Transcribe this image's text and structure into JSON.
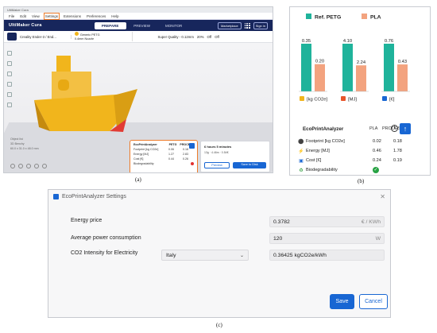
{
  "panel_a": {
    "window_title": "UltiMaker Cura",
    "menu": [
      "File",
      "Edit",
      "View",
      "Settings",
      "Extensions",
      "Preferences",
      "Help"
    ],
    "highlighted_menu": "Settings",
    "logo": "UltiMaker Cura",
    "stages": [
      "PREPARE",
      "PREVIEW",
      "MONITOR"
    ],
    "active_stage": "PREPARE",
    "marketplace": "Marketplace",
    "sign_in": "Sign in",
    "printer": "Creality Ender-3 / End...",
    "material_line1": "Generic PETG",
    "material_line2": "0.4mm Nozzle",
    "quality": "Super Quality - 0.12mm",
    "infill": "20%",
    "support": "Off",
    "adhesion": "Off",
    "object_info": [
      "Object list",
      "3D Benchy",
      "60.0 x 31.0 x 48.0 mm"
    ],
    "mini_plugin": {
      "title": "EcoPrintAnalyzer",
      "col1": "PETG",
      "col2": "PROCESS",
      "rows": [
        {
          "label": "Footprint [kg CO2e]",
          "v1": "0.06",
          "v2": "0.18"
        },
        {
          "label": "Energy [MJ]",
          "v1": "1.27",
          "v2": "2.83"
        },
        {
          "label": "Cost [€]",
          "v1": "0.44",
          "v2": "0.26"
        },
        {
          "label": "Biodegradability",
          "v1": "",
          "v2": ""
        }
      ]
    },
    "print_time": "6 hours 5 minutes",
    "print_material": "13g · 4.46m · 0.54€",
    "preview_label": "Preview",
    "save_label": "Save to Disk",
    "caption": "(a)"
  },
  "panel_b": {
    "chart_data": {
      "type": "bar",
      "categories": [
        "[kg CO2e]",
        "[MJ]",
        "[€]"
      ],
      "series": [
        {
          "name": "Ref. PETG",
          "values": [
            0.35,
            4.1,
            0.76
          ],
          "labels": [
            "0.35",
            "4.10",
            "0.76"
          ],
          "color": "#1fb39b"
        },
        {
          "name": "PLA",
          "values": [
            0.2,
            2.24,
            0.43
          ],
          "labels": [
            "0.20",
            "2.24",
            "0.43"
          ],
          "color": "#f3a37f"
        }
      ],
      "icons": [
        "footprint-icon",
        "lightning-icon",
        "euro-icon"
      ],
      "title": "",
      "legend_position": "top"
    },
    "plugin": {
      "title": "EcoPrintAnalyzer",
      "col1": "PLA",
      "col2": "PROCESS",
      "info": "i",
      "rows": [
        {
          "icon": "footprint-icon",
          "label": "Footprint [kg CO2e]",
          "v1": "0.02",
          "v2": "0.18"
        },
        {
          "icon": "lightning-icon",
          "label": "Energy [MJ]",
          "v1": "0.46",
          "v2": "1.78"
        },
        {
          "icon": "cost-icon",
          "label": "Cost [€]",
          "v1": "0.24",
          "v2": "0.19"
        },
        {
          "icon": "recycle-icon",
          "label": "Biodegradability",
          "v1": "",
          "v2": ""
        }
      ]
    },
    "caption": "(b)"
  },
  "panel_c": {
    "title": "EcoPrintAnalyzer Settings",
    "energy_price_label": "Energy price",
    "energy_price_value": "0.3782",
    "energy_price_unit": "€ / KWh",
    "power_label": "Average power consumption",
    "power_value": "120",
    "power_unit": "W",
    "co2_label": "CO2 Intensity for Electricity",
    "country": "Italy",
    "co2_value": "0.36425 kgCO2e/kWh",
    "save_label": "Save",
    "cancel_label": "Cancel",
    "caption": "(c)"
  },
  "colors": {
    "cura_navy": "#17265c",
    "accent_blue": "#1866d3",
    "highlight_orange": "#ef7c2a",
    "petg_teal": "#1fb39b",
    "pla_salmon": "#f3a37f",
    "benchy_yellow": "#f1b51c"
  }
}
